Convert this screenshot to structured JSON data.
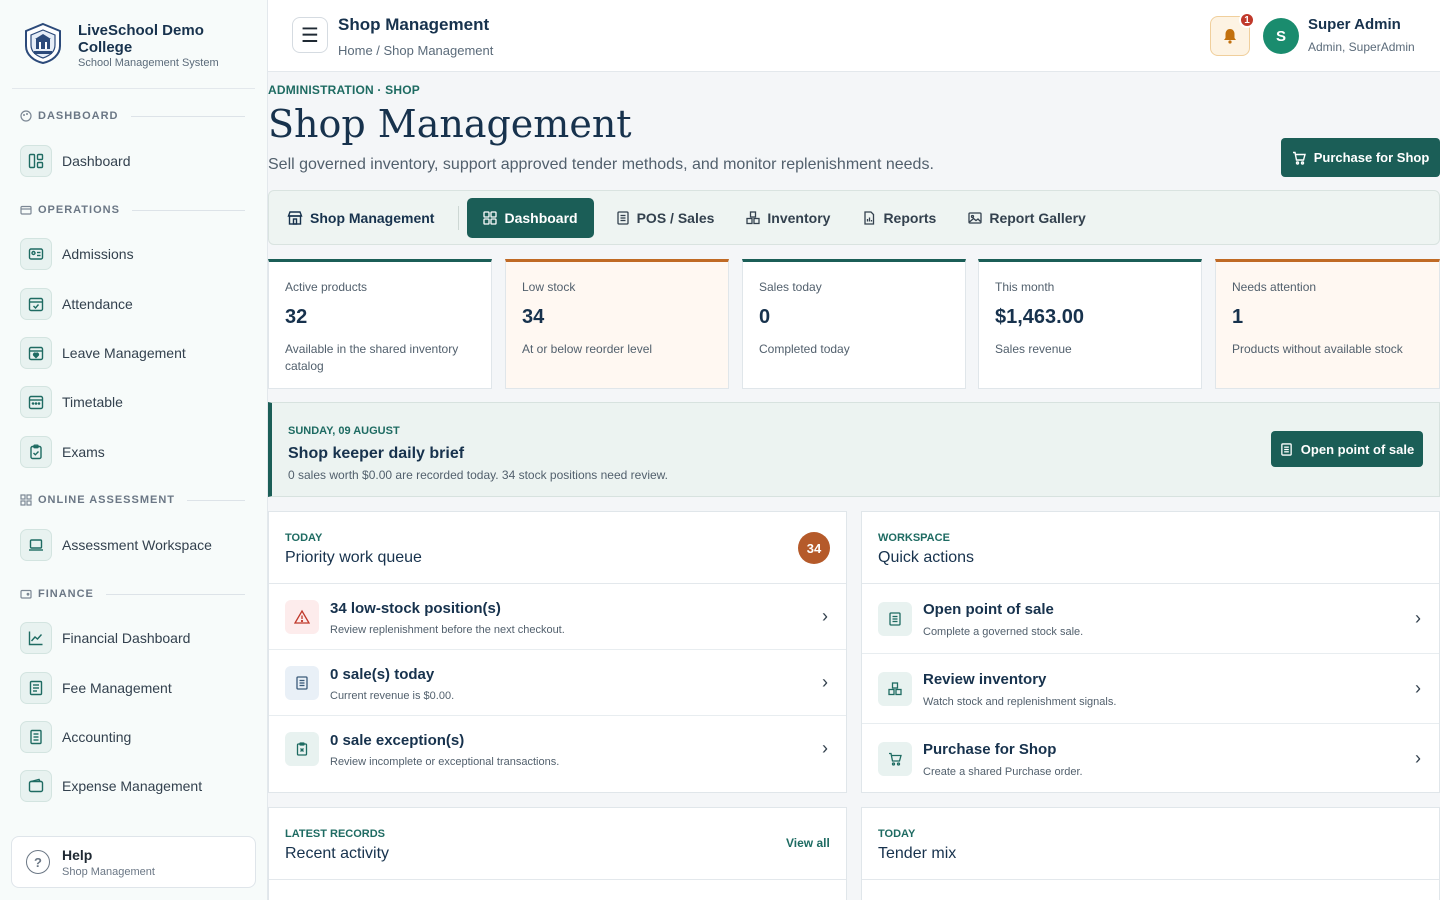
{
  "sidebar": {
    "brand_name": "LiveSchool Demo College",
    "brand_sub": "School Management System",
    "sections": [
      {
        "label": "DASHBOARD",
        "icon": "palette-icon"
      },
      {
        "label": "OPERATIONS",
        "icon": "folder-icon"
      },
      {
        "label": "ONLINE ASSESSMENT",
        "icon": "grid-icon"
      },
      {
        "label": "FINANCE",
        "icon": "wallet-icon"
      }
    ],
    "items": [
      {
        "label": "Dashboard",
        "icon": "dashboard-icon"
      },
      {
        "label": "Admissions",
        "icon": "id-card-icon"
      },
      {
        "label": "Attendance",
        "icon": "calendar-check-icon"
      },
      {
        "label": "Leave Management",
        "icon": "calendar-heart-icon"
      },
      {
        "label": "Timetable",
        "icon": "calendar-icon"
      },
      {
        "label": "Exams",
        "icon": "clipboard-check-icon"
      },
      {
        "label": "Assessment Workspace",
        "icon": "laptop-icon"
      },
      {
        "label": "Financial Dashboard",
        "icon": "trend-chart-icon"
      },
      {
        "label": "Fee Management",
        "icon": "receipt-icon"
      },
      {
        "label": "Accounting",
        "icon": "ledger-icon"
      },
      {
        "label": "Expense Management",
        "icon": "wallet-icon"
      }
    ],
    "help": {
      "title": "Help",
      "sub": "Shop Management"
    }
  },
  "topbar": {
    "title": "Shop Management",
    "breadcrumb": "Home / Shop Management",
    "notifications": "1",
    "avatar_letter": "S",
    "user_name": "Super Admin",
    "user_role": "Admin, SuperAdmin"
  },
  "page": {
    "eyebrow": "ADMINISTRATION · SHOP",
    "title": "Shop Management",
    "subtitle": "Sell governed inventory, support approved tender methods, and monitor replenishment needs.",
    "primary_action": "Purchase for Shop"
  },
  "tabs": [
    {
      "label": "Shop Management",
      "icon": "store-icon"
    },
    {
      "label": "Dashboard",
      "icon": "grid-icon"
    },
    {
      "label": "POS / Sales",
      "icon": "receipt-icon"
    },
    {
      "label": "Inventory",
      "icon": "boxes-icon"
    },
    {
      "label": "Reports",
      "icon": "report-icon"
    },
    {
      "label": "Report Gallery",
      "icon": "image-icon"
    }
  ],
  "stats": [
    {
      "label": "Active products",
      "value": "32",
      "desc": "Available in the shared inventory catalog"
    },
    {
      "label": "Low stock",
      "value": "34",
      "desc": "At or below reorder level"
    },
    {
      "label": "Sales today",
      "value": "0",
      "desc": "Completed today"
    },
    {
      "label": "This month",
      "value": "$1,463.00",
      "desc": "Sales revenue"
    },
    {
      "label": "Needs attention",
      "value": "1",
      "desc": "Products without available stock"
    }
  ],
  "brief": {
    "date": "SUNDAY, 09 AUGUST",
    "title": "Shop keeper daily brief",
    "summary": "0 sales worth $0.00 are recorded today. 34 stock positions need review.",
    "action": "Open point of sale"
  },
  "queue": {
    "eyebrow": "TODAY",
    "title": "Priority work queue",
    "badge": "34",
    "rows": [
      {
        "title": "34 low-stock position(s)",
        "sub": "Review replenishment before the next checkout.",
        "icon": "warning-icon"
      },
      {
        "title": "0 sale(s) today",
        "sub": "Current revenue is $0.00.",
        "icon": "receipt-icon"
      },
      {
        "title": "0 sale exception(s)",
        "sub": "Review incomplete or exceptional transactions.",
        "icon": "clipboard-x-icon"
      }
    ]
  },
  "quick": {
    "eyebrow": "WORKSPACE",
    "title": "Quick actions",
    "rows": [
      {
        "title": "Open point of sale",
        "sub": "Complete a governed stock sale.",
        "icon": "receipt-icon"
      },
      {
        "title": "Review inventory",
        "sub": "Watch stock and replenishment signals.",
        "icon": "boxes-icon"
      },
      {
        "title": "Purchase for Shop",
        "sub": "Create a shared Purchase order.",
        "icon": "cart-icon"
      }
    ]
  },
  "recent": {
    "eyebrow": "LATEST RECORDS",
    "title": "Recent activity",
    "view_all": "View all"
  },
  "tender": {
    "eyebrow": "TODAY",
    "title": "Tender mix"
  },
  "colors": {
    "accent": "#1b5e57",
    "warning": "#c06a25",
    "danger": "#c0392b"
  }
}
